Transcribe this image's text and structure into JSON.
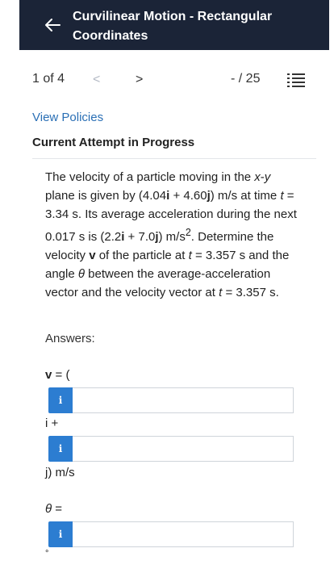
{
  "header": {
    "title": "Curvilinear Motion - Rectangular Coordinates"
  },
  "pager": {
    "page_label": "1 of 4",
    "prev_symbol": "<",
    "next_symbol": ">",
    "score": "- / 25"
  },
  "policies_link": "View Policies",
  "attempt_heading": "Current Attempt in Progress",
  "question": {
    "s1": "The velocity of a particle moving in the ",
    "x": "x",
    "dash": "-",
    "y": "y",
    "s2": " plane is given by (4.04",
    "i1": "i",
    "s3": " + 4.60",
    "j1": "j",
    "s4": ") m/s at time ",
    "t1": "t",
    "s5": " = 3.34 s. Its average acceleration during the next 0.017 s is (2.2",
    "i2": "i",
    "s6": " + 7.0",
    "j2": "j",
    "s7": ") m/s",
    "sup": "2",
    "s8": ". Determine the velocity ",
    "v": "v",
    "s9": " of the particle at ",
    "t2": "t",
    "s10": " = 3.357 s and the angle ",
    "theta": "θ",
    "s11": " between the average-acceleration vector and the velocity vector at ",
    "t3": "t",
    "s12": " = 3.357 s."
  },
  "answers_label": "Answers:",
  "labels": {
    "v_open_bold": "v",
    "v_open_rest": " = (",
    "i_plus": "i +",
    "j_unit": "j) m/s",
    "theta": "θ",
    "theta_rest": " =",
    "degree": "°"
  },
  "info_icon": "i",
  "inputs": {
    "vx": "",
    "vy": "",
    "theta": ""
  },
  "colors": {
    "header_bg": "#1b2437",
    "link": "#2a6fb5",
    "info_button": "#2c7dd1"
  },
  "icons": [
    "back-arrow-icon",
    "prev-chevron-icon",
    "next-chevron-icon",
    "question-list-icon",
    "info-icon"
  ]
}
